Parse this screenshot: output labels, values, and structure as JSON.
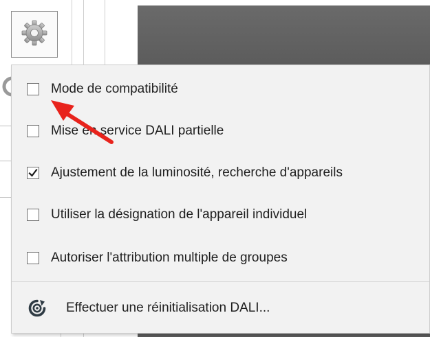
{
  "toolbar": {
    "gear_icon": "gear-icon"
  },
  "menu": {
    "items": [
      {
        "label": "Mode de compatibilité",
        "checked": false
      },
      {
        "label": "Mise en service DALI partielle",
        "checked": false
      },
      {
        "label": "Ajustement de la luminosité, recherche d'appareils",
        "checked": true
      },
      {
        "label": "Utiliser la désignation de l'appareil individuel",
        "checked": false
      },
      {
        "label": "Autoriser l'attribution multiple de groupes",
        "checked": false
      }
    ],
    "reset": {
      "label": "Effectuer une réinitialisation DALI...",
      "icon": "reset-icon"
    }
  },
  "colors": {
    "menu_background": "#f2f2f2",
    "annotation_arrow": "#e8231c",
    "reset_icon": "#2f3b44",
    "dark_panel": "#606060"
  }
}
